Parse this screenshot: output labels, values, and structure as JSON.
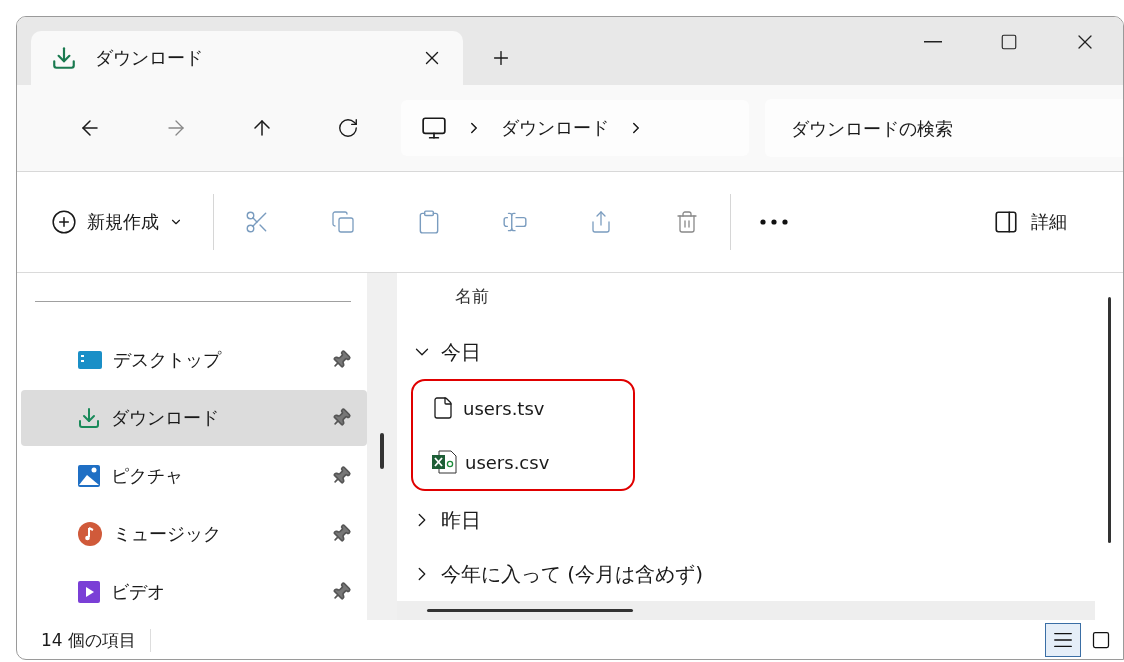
{
  "tab": {
    "title": "ダウンロード",
    "selected": true
  },
  "address": {
    "crumbs": [
      "ダウンロード"
    ],
    "search_placeholder": "ダウンロードの検索"
  },
  "toolbar": {
    "new_label": "新規作成",
    "details_label": "詳細"
  },
  "sidebar": {
    "items": [
      {
        "label": "デスクトップ",
        "kind": "desktop",
        "selected": false,
        "pinned": true
      },
      {
        "label": "ダウンロード",
        "kind": "downloads",
        "selected": true,
        "pinned": true
      },
      {
        "label": "ピクチャ",
        "kind": "pictures",
        "selected": false,
        "pinned": true
      },
      {
        "label": "ミュージック",
        "kind": "music",
        "selected": false,
        "pinned": true
      },
      {
        "label": "ビデオ",
        "kind": "videos",
        "selected": false,
        "pinned": true
      }
    ]
  },
  "list": {
    "column": "名前",
    "groups": [
      {
        "label": "今日",
        "expanded": true,
        "annotated": true,
        "files": [
          {
            "name": "users.tsv",
            "kind": "text"
          },
          {
            "name": "users.csv",
            "kind": "excel"
          }
        ]
      },
      {
        "label": "昨日",
        "expanded": false
      },
      {
        "label": "今年に入って (今月は含めず)",
        "expanded": false
      }
    ]
  },
  "status_bar": {
    "count": "14 個の項目",
    "views": [
      {
        "kind": "details",
        "selected": true
      },
      {
        "kind": "tiles",
        "selected": false
      }
    ]
  }
}
